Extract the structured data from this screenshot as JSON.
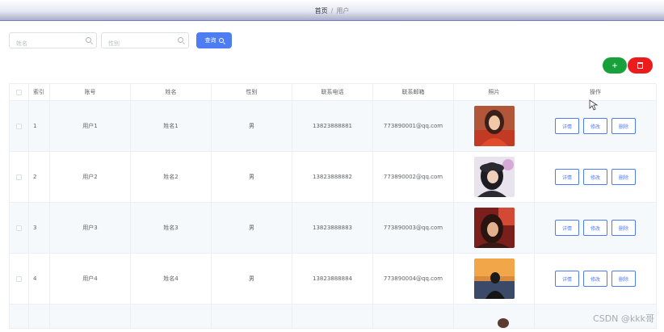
{
  "breadcrumb": {
    "home": "首页",
    "sep": "/",
    "current": "用户"
  },
  "search": {
    "name_placeholder": "姓名",
    "gender_placeholder": "性别",
    "query_label": "查询"
  },
  "toolbar": {
    "add_label": "+"
  },
  "columns": [
    "索引",
    "账号",
    "姓名",
    "性别",
    "联系电话",
    "联系邮箱",
    "照片",
    "操作"
  ],
  "rows": [
    {
      "index": "1",
      "account": "用户1",
      "name": "姓名1",
      "gender": "男",
      "phone": "13823888881",
      "email": "773890001@qq.com"
    },
    {
      "index": "2",
      "account": "用户2",
      "name": "姓名2",
      "gender": "男",
      "phone": "13823888882",
      "email": "773890002@qq.com"
    },
    {
      "index": "3",
      "account": "用户3",
      "name": "姓名3",
      "gender": "男",
      "phone": "13823888883",
      "email": "773890003@qq.com"
    },
    {
      "index": "4",
      "account": "用户4",
      "name": "姓名4",
      "gender": "男",
      "phone": "13823888884",
      "email": "773890004@qq.com"
    }
  ],
  "actions": {
    "detail": "详情",
    "edit": "修改",
    "delete": "删除"
  },
  "watermark": "CSDN @kkk哥",
  "colors": {
    "primary": "#4d7cf3",
    "success": "#18a03a",
    "danger": "#ec1c1c"
  }
}
